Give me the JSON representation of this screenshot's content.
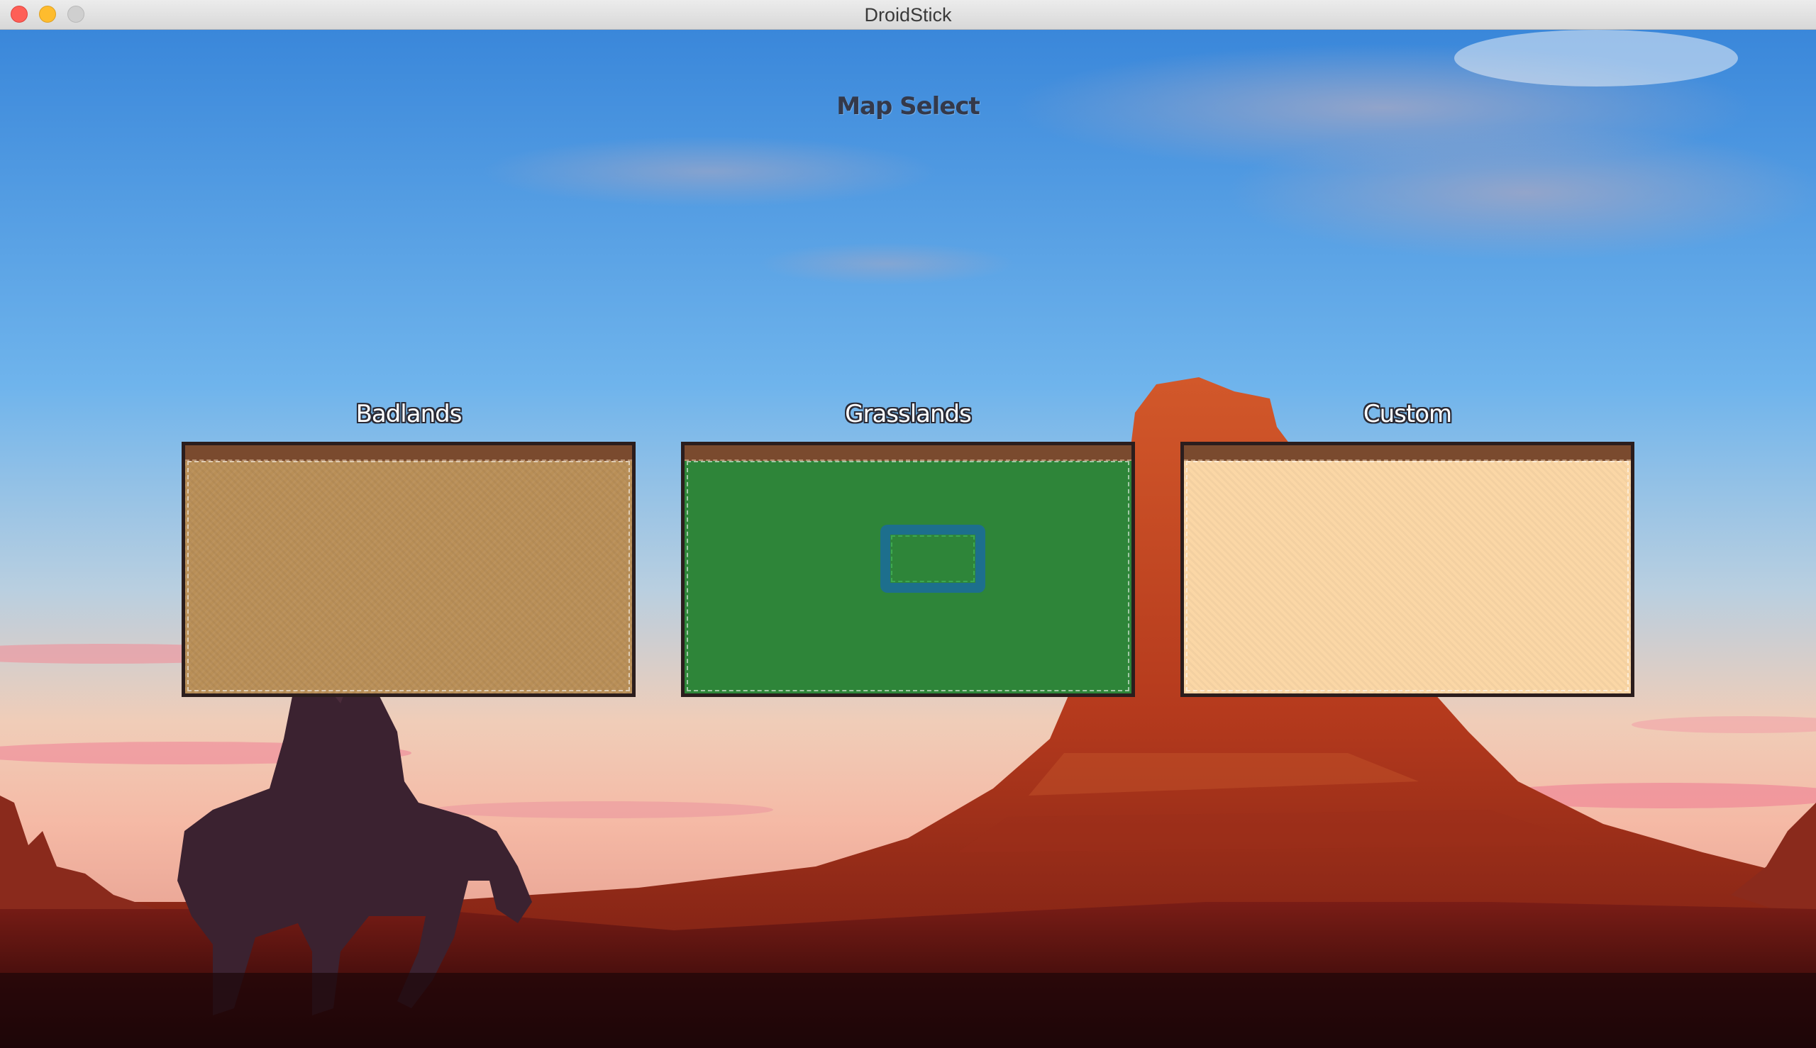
{
  "window": {
    "title": "DroidStick"
  },
  "screen": {
    "heading": "Map Select"
  },
  "maps": [
    {
      "label": "Badlands",
      "color": "#b98f57"
    },
    {
      "label": "Grasslands",
      "color": "#2e8539",
      "water_color": "#1d6f8d"
    },
    {
      "label": "Custom",
      "color": "#fbd7a6"
    }
  ],
  "colors": {
    "card_border": "#2b1d1d",
    "card_top_strip": "#7a4a2e",
    "sky_top": "#3f8fdc",
    "mesa": "#b23a1c"
  }
}
